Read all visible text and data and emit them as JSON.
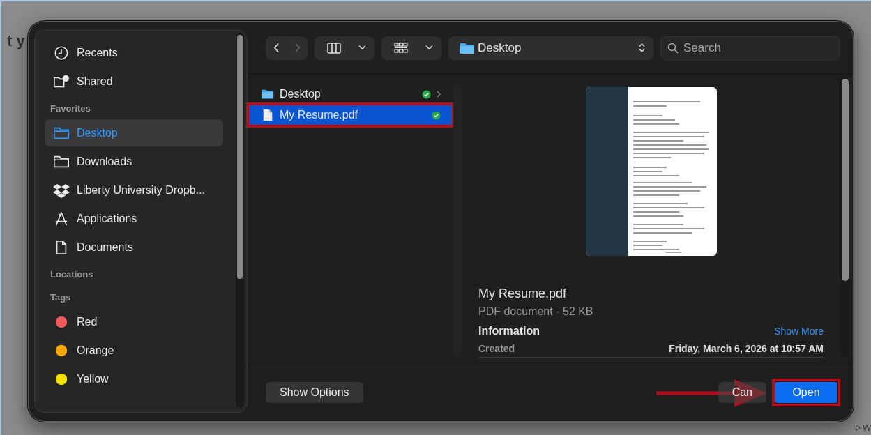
{
  "background": {
    "heading_fragment": "t y",
    "side_fragment": "W"
  },
  "sidebar": {
    "top": [
      {
        "label": "Recents",
        "kind": "clock",
        "selected": false
      },
      {
        "label": "Shared",
        "kind": "shared",
        "selected": false
      }
    ],
    "sections": [
      {
        "title": "Favorites",
        "items": [
          {
            "label": "Desktop",
            "kind": "folder",
            "selected": true
          },
          {
            "label": "Downloads",
            "kind": "folder",
            "selected": false
          },
          {
            "label": "Liberty University Dropb...",
            "kind": "dropbox",
            "selected": false
          },
          {
            "label": "Applications",
            "kind": "apps",
            "selected": false
          },
          {
            "label": "Documents",
            "kind": "document",
            "selected": false
          }
        ]
      },
      {
        "title": "Locations"
      },
      {
        "title": "Tags",
        "items": [
          {
            "label": "Red",
            "kind": "tag",
            "color": "#f05a5a",
            "selected": false
          },
          {
            "label": "Orange",
            "kind": "tag",
            "color": "#f7a800",
            "selected": false
          },
          {
            "label": "Yellow",
            "kind": "tag",
            "color": "#f5e000",
            "selected": false
          }
        ]
      }
    ]
  },
  "toolbar": {
    "nav": [
      {
        "kind": "back",
        "disabled": false
      },
      {
        "kind": "forward",
        "disabled": true
      }
    ],
    "views": [
      {
        "kind": "columns"
      },
      {
        "kind": "gallery"
      }
    ],
    "location": "Desktop",
    "search": {
      "placeholder": "Search"
    }
  },
  "files": [
    {
      "name": "Desktop",
      "kind": "folder",
      "selected": false,
      "synced": true,
      "has_children": true,
      "highlighted": false
    },
    {
      "name": "My Resume.pdf",
      "kind": "pdf",
      "selected": true,
      "synced": true,
      "has_children": false,
      "highlighted": true
    }
  ],
  "preview": {
    "title": "My Resume.pdf",
    "subtitle": "PDF document - 52 KB",
    "info_heading": "Information",
    "show_more": "Show More",
    "fields": [
      {
        "label": "Created",
        "value": "Friday, March 6, 2026 at 10:57 AM"
      }
    ]
  },
  "buttons": [
    {
      "label": "Show Options",
      "kind": "options",
      "highlighted": false
    },
    {
      "label": "Can",
      "kind": "cancel",
      "highlighted": false
    },
    {
      "label": "Open",
      "kind": "default",
      "highlighted": true
    }
  ],
  "annotation_arrow": true
}
